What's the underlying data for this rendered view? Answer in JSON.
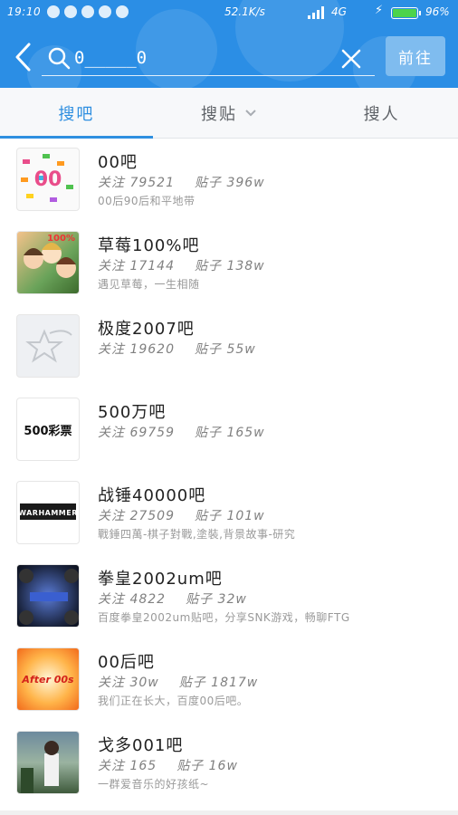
{
  "status_bar": {
    "time": "19:10",
    "speed": "52.1K/s",
    "network": "4G",
    "battery": "96%",
    "battery_color": "#4cd34c"
  },
  "search": {
    "query": "0_____0",
    "go_label": "前往"
  },
  "tabs": [
    {
      "label": "搜吧",
      "active": true
    },
    {
      "label": "搜贴",
      "active": false,
      "icon": "chevron-down-icon"
    },
    {
      "label": "搜人",
      "active": false
    }
  ],
  "results": [
    {
      "name": "00吧",
      "followers_label": "关注",
      "followers": "79521",
      "posts_label": "贴子",
      "posts": "396w",
      "desc": "00后90后和平地带",
      "avatar_text": "00"
    },
    {
      "name": "草莓100%吧",
      "followers_label": "关注",
      "followers": "17144",
      "posts_label": "贴子",
      "posts": "138w",
      "desc": "遇见草莓，一生相随",
      "avatar_text": "100%"
    },
    {
      "name": "极度2007吧",
      "followers_label": "关注",
      "followers": "19620",
      "posts_label": "贴子",
      "posts": "55w",
      "desc": "",
      "avatar_text": ""
    },
    {
      "name": "500万吧",
      "followers_label": "关注",
      "followers": "69759",
      "posts_label": "贴子",
      "posts": "165w",
      "desc": "",
      "avatar_text": "500彩票"
    },
    {
      "name": "战锤40000吧",
      "followers_label": "关注",
      "followers": "27509",
      "posts_label": "贴子",
      "posts": "101w",
      "desc": "戰錘四萬-棋子對戰,塗裝,背景故事-研究",
      "avatar_text": "WARHAMMER"
    },
    {
      "name": "拳皇2002um吧",
      "followers_label": "关注",
      "followers": "4822",
      "posts_label": "贴子",
      "posts": "32w",
      "desc": "百度拳皇2002um贴吧，分享SNK游戏，畅聊FTG",
      "avatar_text": ""
    },
    {
      "name": "00后吧",
      "followers_label": "关注",
      "followers": "30w",
      "posts_label": "贴子",
      "posts": "1817w",
      "desc": "我们正在长大，百度00后吧。",
      "avatar_text": "After 00s"
    },
    {
      "name": "戈多001吧",
      "followers_label": "关注",
      "followers": "165",
      "posts_label": "贴子",
      "posts": "16w",
      "desc": "一群爱音乐的好孩纸~",
      "avatar_text": ""
    }
  ]
}
